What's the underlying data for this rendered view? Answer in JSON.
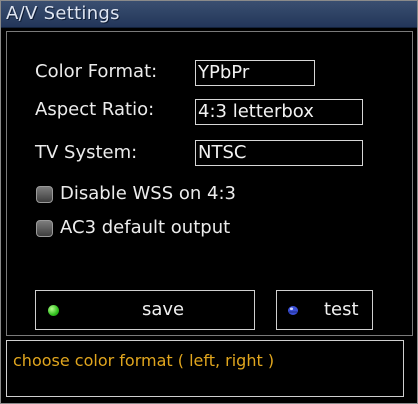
{
  "window": {
    "title": "A/V Settings"
  },
  "settings": {
    "color_format": {
      "label": "Color Format:",
      "value": "YPbPr"
    },
    "aspect_ratio": {
      "label": "Aspect Ratio:",
      "value": "4:3 letterbox"
    },
    "tv_system": {
      "label": "TV System:",
      "value": "NTSC"
    }
  },
  "options": {
    "disable_wss": {
      "label": "Disable WSS on 4:3",
      "checked": false
    },
    "ac3_default": {
      "label": "AC3 default output",
      "checked": false
    }
  },
  "buttons": {
    "save": {
      "label": "save",
      "indicator_color": "#3fd12a"
    },
    "test": {
      "label": "test",
      "indicator_color": "#3b4fd6"
    }
  },
  "status": {
    "text": "choose color format ( left, right )",
    "color": "#e1a61e"
  },
  "theme": {
    "titlebar": "#2d4163",
    "text": "#ececec"
  }
}
